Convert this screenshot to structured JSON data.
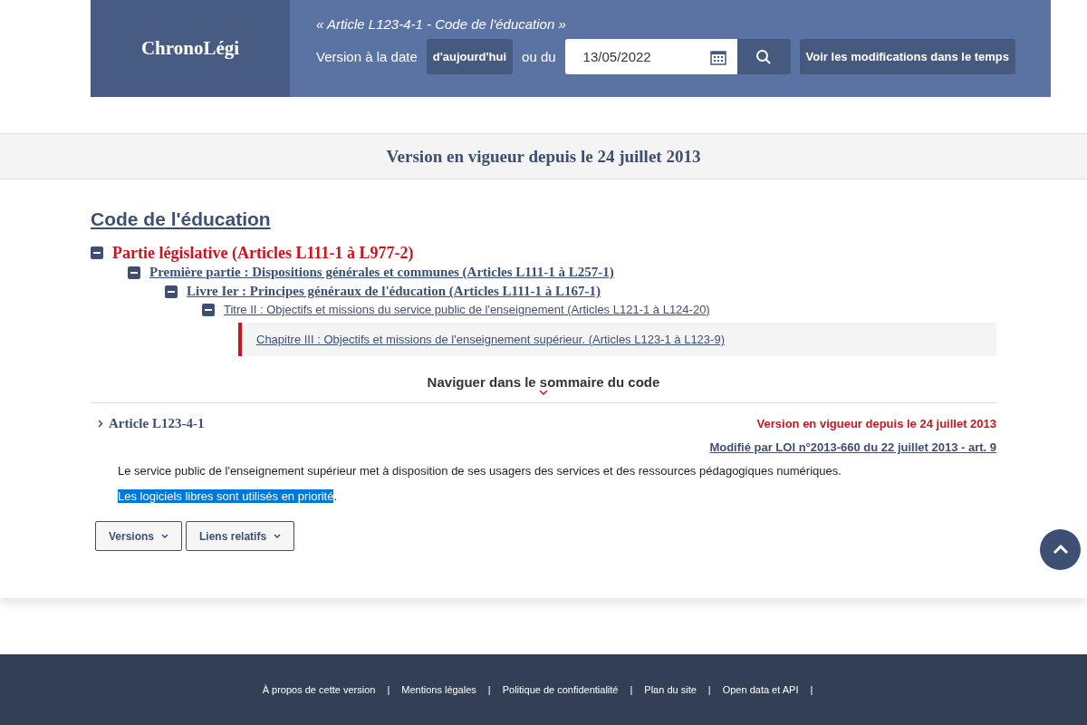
{
  "header": {
    "logo": "ChronoLégi",
    "subtitle": "« Article L123-4-1 - Code de l'éducation »",
    "version_label": "Version à la date",
    "today_button": "d'aujourd'hui",
    "or_label": "ou du",
    "date_value": "13/05/2022",
    "changes_button": "Voir les modifications dans le temps"
  },
  "version_banner": "Version en vigueur depuis le 24 juillet 2013",
  "code_title": "Code de l'éducation",
  "tree": [
    {
      "label": "Partie législative (Articles L111-1 à L977-2)",
      "expanded": true,
      "selected": false,
      "children": [
        {
          "label": "Première partie : Dispositions générales et communes",
          "range": "(Articles L111-1 à L257-1)",
          "expanded": true,
          "selected": false,
          "children": [
            {
              "label": "Livre Ier : Principes généraux de l'éducation",
              "range": "(Articles L111-1 à L167-1)",
              "expanded": true,
              "selected": false,
              "children": [
                {
                  "label": "Titre II : Objectifs et missions du service public de l'enseignement",
                  "range": "(Articles L121-1 à L124-20)",
                  "expanded": true,
                  "selected": false,
                  "children": [
                    {
                      "label": "Chapitre III : Objectifs et missions de l'enseignement supérieur.",
                      "range": "(Articles L123-1 à L123-9)",
                      "selected": true
                    }
                  ]
                }
              ]
            }
          ]
        }
      ]
    }
  ],
  "navigate_label": "Naviguer dans le sommaire du code",
  "article": {
    "title": "Article L123-4-1",
    "status": "Version en vigueur depuis le 24 juillet 2013",
    "modified_by": "Modifié par LOI n°2013-660 du 22 juillet 2013 - art. 9",
    "paragraphs": [
      [
        {
          "text": "Le service public de l'enseignement supérieur met à disposition de ses usagers des services et des ressources pédagogiques numériques.",
          "highlighted": false
        }
      ],
      [
        {
          "text": "Les logiciels libres sont utilisés en priorité",
          "highlighted": true
        },
        {
          "text": ".",
          "highlighted": false
        }
      ]
    ],
    "buttons": [
      "Versions",
      "Liens relatifs"
    ]
  },
  "footer": {
    "links": [
      {
        "label": "À propos de cette version",
        "separator": "|"
      },
      {
        "label": "Mentions légales",
        "separator": "|"
      },
      {
        "label": "Politique de confidentialité",
        "separator": "|"
      },
      {
        "label": "Plan du site",
        "separator": "|"
      },
      {
        "label": "Open data et API",
        "separator": "|"
      }
    ]
  }
}
